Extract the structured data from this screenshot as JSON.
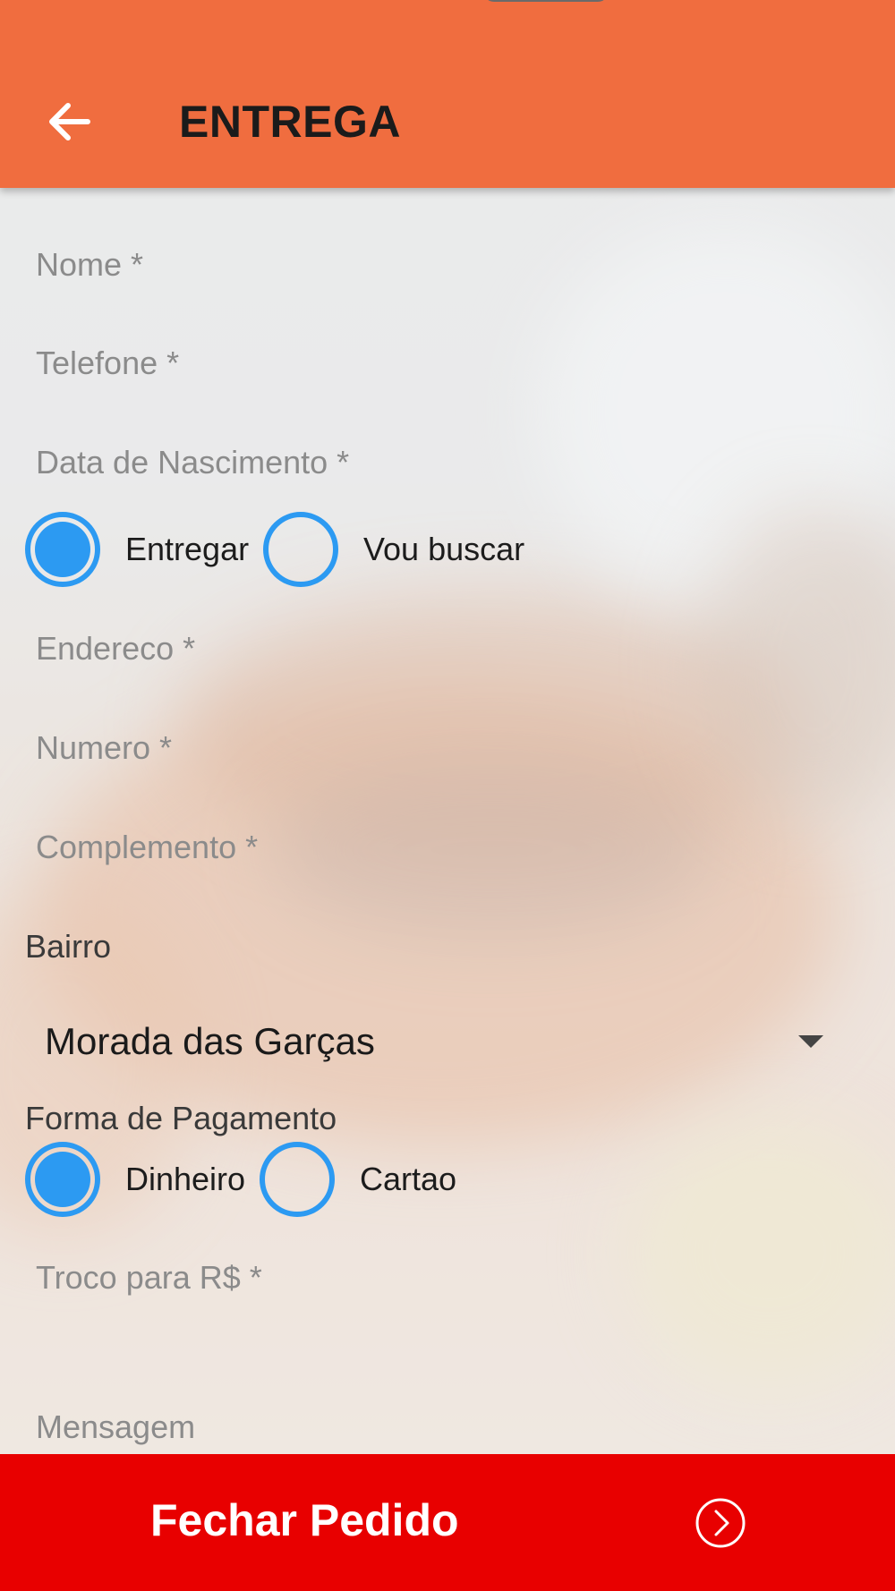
{
  "header": {
    "title": "ENTREGA",
    "back_icon": "arrow-left-icon",
    "color": "#f06d3f"
  },
  "form": {
    "nome_placeholder": "Nome *",
    "telefone_placeholder": "Telefone *",
    "nascimento_placeholder": "Data de Nascimento *",
    "delivery_options": [
      {
        "label": "Entregar",
        "selected": true
      },
      {
        "label": "Vou buscar",
        "selected": false
      }
    ],
    "endereco_placeholder": "Endereco *",
    "numero_placeholder": "Numero *",
    "complemento_placeholder": "Complemento *",
    "bairro_label": "Bairro",
    "bairro_value": "Morada das Garças",
    "pagamento_label": "Forma de Pagamento",
    "payment_options": [
      {
        "label": "Dinheiro",
        "selected": true
      },
      {
        "label": "Cartao",
        "selected": false
      }
    ],
    "troco_placeholder": "Troco para R$ *",
    "mensagem_placeholder": "Mensagem"
  },
  "footer": {
    "button_label": "Fechar Pedido",
    "button_icon": "chevron-right-circle-icon",
    "color": "#e80000"
  },
  "accent_color": "#2c9af2"
}
